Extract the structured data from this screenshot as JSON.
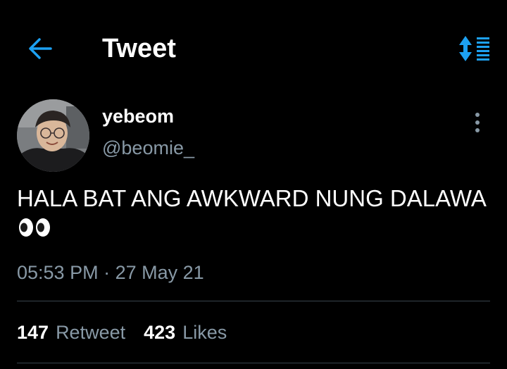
{
  "header": {
    "title": "Tweet",
    "back_icon": "arrow-left-icon",
    "sort_icon": "sort-list-icon",
    "accent_color": "#1da1f2"
  },
  "author": {
    "name": "yebeom",
    "handle": "@beomie_"
  },
  "tweet": {
    "text": "HALA BAT ANG AWKWARD NUNG DALAWA",
    "emoji": "eyes-emoji",
    "time": "05:53 PM",
    "separator": "·",
    "date": "27 May 21"
  },
  "stats": {
    "retweets": {
      "count": "147",
      "label": "Retweet"
    },
    "likes": {
      "count": "423",
      "label": "Likes"
    }
  },
  "colors": {
    "background": "#000000",
    "primary_text": "#ffffff",
    "secondary_text": "#8899a6",
    "divider": "#38444d"
  }
}
